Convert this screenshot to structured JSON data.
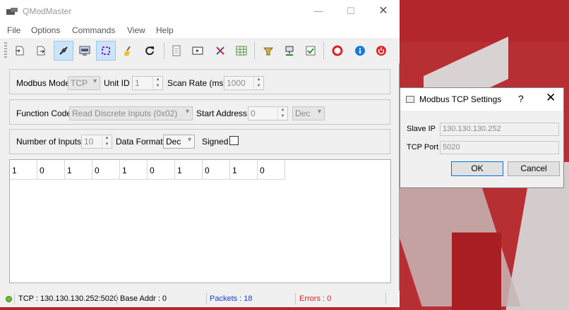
{
  "window": {
    "title": "QModMaster",
    "controls": {
      "minimize": "—",
      "maximize": "☐",
      "close": "✕"
    }
  },
  "menu": [
    "File",
    "Options",
    "Commands",
    "View",
    "Help"
  ],
  "toolbar": {
    "icons": [
      "load-session-icon",
      "save-session-icon",
      "connect-icon",
      "serial-port-icon",
      "scan-icon",
      "clear-icon",
      "reset-icon",
      "bus-monitor-icon",
      "tools-icon",
      "settings-icon",
      "table-icon",
      "headers-icon",
      "network-icon",
      "check-icon",
      "help-icon",
      "about-icon",
      "exit-icon"
    ]
  },
  "connection_group": {
    "modbus_mode_label": "Modbus Mode",
    "modbus_mode_value": "TCP",
    "unit_id_label": "Unit ID",
    "unit_id_value": "1",
    "scan_rate_label": "Scan Rate (ms)",
    "scan_rate_value": "1000"
  },
  "function_group": {
    "function_code_label": "Function Code",
    "function_code_value": "Read Discrete Inputs (0x02)",
    "start_address_label": "Start Address",
    "start_address_value": "0",
    "address_format_value": "Dec"
  },
  "inputs_group": {
    "number_of_inputs_label": "Number of Inputs",
    "number_of_inputs_value": "10",
    "data_format_label": "Data Format",
    "data_format_value": "Dec",
    "signed_label": "Signed",
    "signed_checked": false
  },
  "data_table": {
    "values": [
      "1",
      "0",
      "1",
      "0",
      "1",
      "0",
      "1",
      "0",
      "1",
      "0"
    ]
  },
  "status_bar": {
    "connection": "TCP : 130.130.130.252:5020",
    "base_addr": "Base Addr : 0",
    "packets": "Packets : 18",
    "errors": "Errors : 0",
    "colors": {
      "packets": "#1a3fbf",
      "errors": "#e02020",
      "led": "#6bbf2a"
    }
  },
  "tcp_dialog": {
    "title": "Modbus TCP Settings",
    "help": "?",
    "close": "✕",
    "slave_ip_label": "Slave IP",
    "slave_ip_value": "130.130.130.252",
    "tcp_port_label": "TCP Port",
    "tcp_port_value": "5020",
    "ok_label": "OK",
    "cancel_label": "Cancel"
  }
}
